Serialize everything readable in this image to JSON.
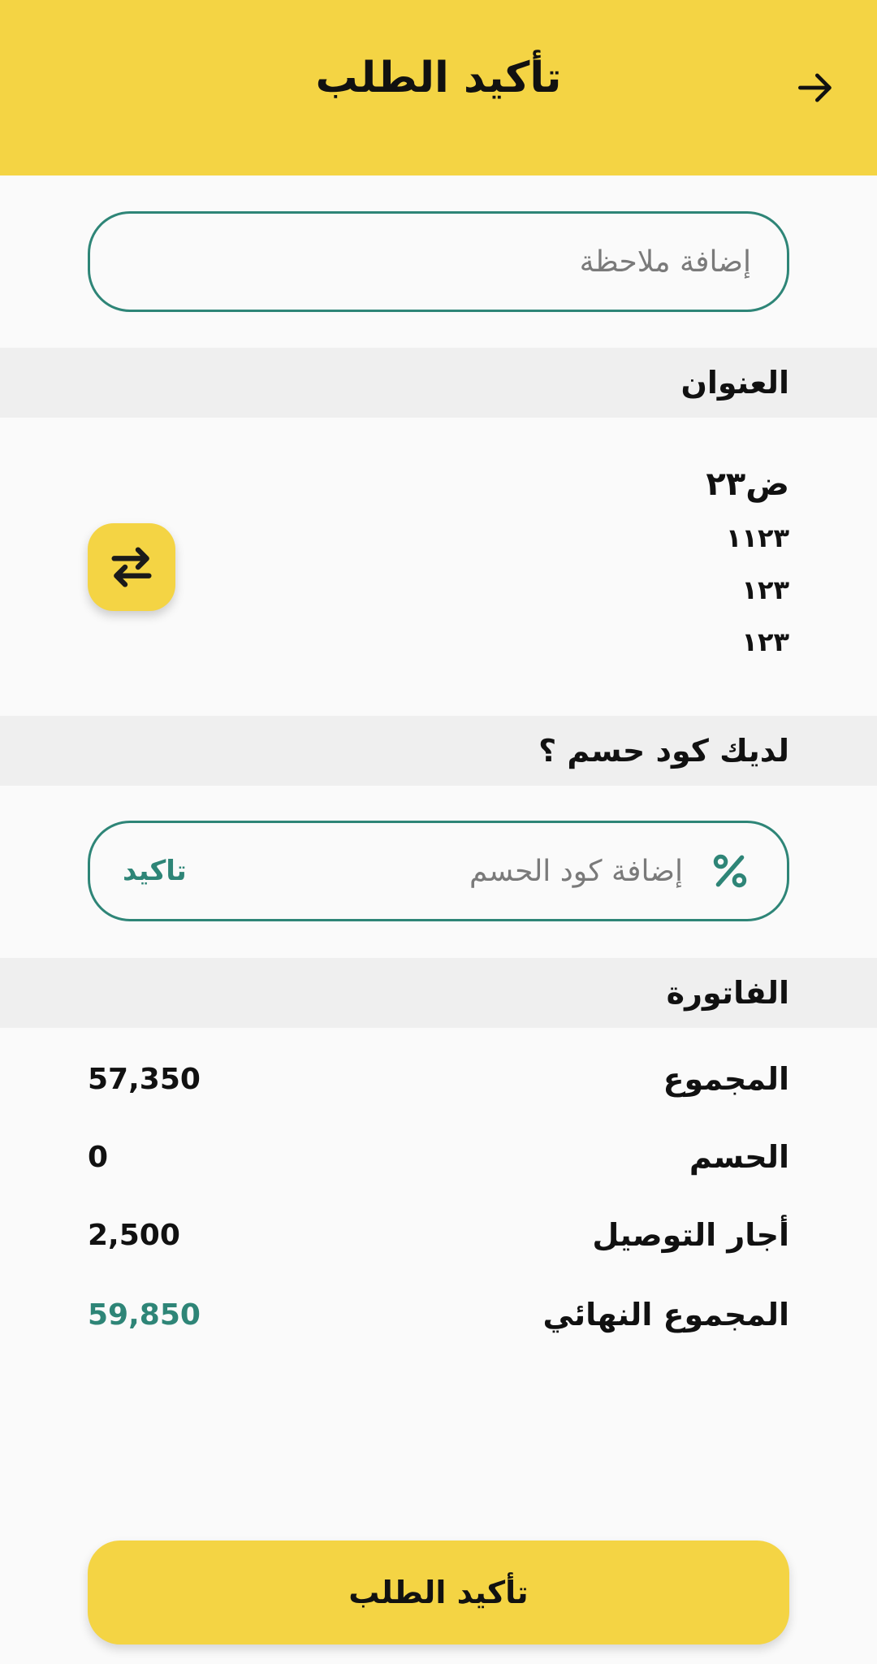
{
  "header": {
    "title": "تأكيد الطلب",
    "back_icon": "arrow-right-icon"
  },
  "note": {
    "placeholder": "إضافة ملاحظة",
    "value": ""
  },
  "address": {
    "section_title": "العنوان",
    "name": "ض٢٣",
    "lines": [
      "١١٢٣",
      "١٢٣",
      "١٢٣"
    ],
    "swap_icon": "swap-arrows-icon"
  },
  "promo": {
    "section_title": "لديك كود حسم ؟",
    "placeholder": "إضافة كود الحسم",
    "value": "",
    "confirm_label": "تاكيد",
    "icon": "percent-icon"
  },
  "invoice": {
    "section_title": "الفاتورة",
    "rows": [
      {
        "label": "المجموع",
        "value": "57,350"
      },
      {
        "label": "الحسم",
        "value": "0"
      },
      {
        "label": "أجار التوصيل",
        "value": "2,500"
      },
      {
        "label": "المجموع النهائي",
        "value": "59,850"
      }
    ]
  },
  "footer": {
    "confirm_label": "تأكيد  الطلب"
  },
  "colors": {
    "primary": "#f4d444",
    "accent": "#2e8577",
    "section_bg": "#efefef",
    "background": "#fafafa"
  }
}
